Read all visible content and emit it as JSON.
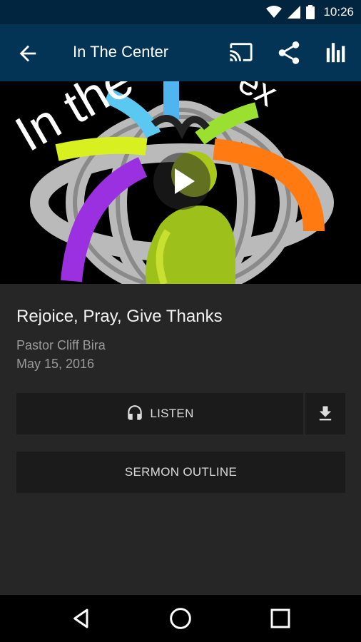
{
  "status_bar": {
    "time": "10:26"
  },
  "app_bar": {
    "title": "In The Center",
    "back_icon": "arrow-back-icon",
    "cast_icon": "cast-icon",
    "share_icon": "share-icon",
    "stats_icon": "equalizer-icon"
  },
  "hero": {
    "artwork_text": "In the",
    "artwork_text_2": "ex",
    "play_icon": "play-icon"
  },
  "sermon": {
    "title": "Rejoice, Pray, Give Thanks",
    "speaker": "Pastor Cliff Bira",
    "date": "May 15, 2016"
  },
  "actions": {
    "listen_label": "LISTEN",
    "listen_icon": "headphones-icon",
    "download_icon": "download-icon",
    "outline_label": "SERMON OUTLINE"
  },
  "nav_bar": {
    "back_icon": "nav-back-icon",
    "home_icon": "nav-home-icon",
    "recents_icon": "nav-recents-icon"
  },
  "colors": {
    "app_bar": "#033456",
    "status_bar": "#01253f",
    "background": "#262626",
    "button": "#1b1b1b"
  }
}
